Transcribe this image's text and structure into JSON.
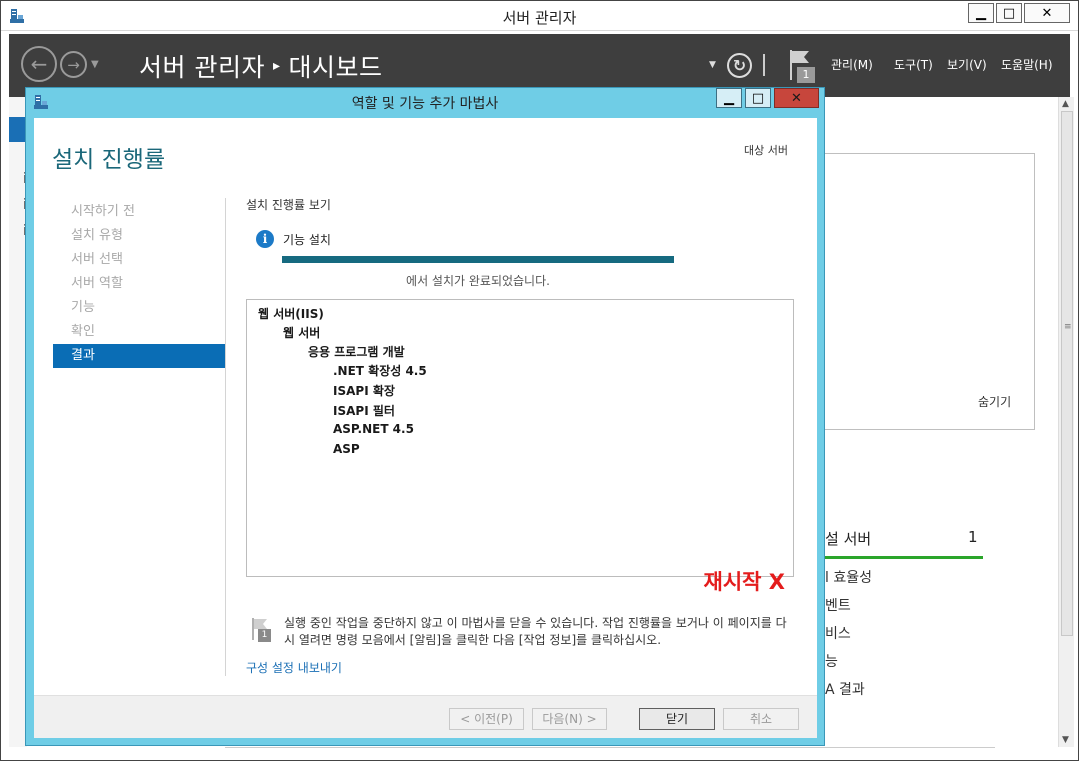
{
  "outer_window": {
    "title": "서버 관리자",
    "controls": {
      "minimize": "▁",
      "maximize": "□",
      "close": "✕"
    }
  },
  "header": {
    "app_name": "서버 관리자",
    "separator": "▸",
    "page_name": "대시보드",
    "menus": [
      "관리(M)",
      "도구(T)",
      "보기(V)",
      "도움말(H)"
    ],
    "notification_count": "1"
  },
  "background": {
    "hide_label": "숨기기",
    "group_title_fragment": "설 서버",
    "group_count": "1",
    "group_bar_color": "#2aa52a",
    "group_items": [
      "l 효율성",
      "벤트",
      "비스",
      "능",
      "A 결과"
    ]
  },
  "wizard": {
    "title": "역할 및 기능 추가 마법사",
    "page_title": "설치 진행률",
    "target_server_label": "대상 서버",
    "steps": [
      {
        "label": "시작하기 전",
        "active": false
      },
      {
        "label": "설치 유형",
        "active": false
      },
      {
        "label": "서버 선택",
        "active": false
      },
      {
        "label": "서버 역할",
        "active": false
      },
      {
        "label": "기능",
        "active": false
      },
      {
        "label": "확인",
        "active": false
      },
      {
        "label": "결과",
        "active": true
      }
    ],
    "view_progress_label": "설치 진행률 보기",
    "feature_install_label": "기능 설치",
    "progress_percent": 100,
    "progress_message": "에서 설치가 완료되었습니다.",
    "results": [
      {
        "text": "웹 서버(IIS)",
        "level": 0
      },
      {
        "text": "웹 서버",
        "level": 1
      },
      {
        "text": "응용 프로그램 개발",
        "level": 2
      },
      {
        "text": ".NET 확장성 4.5",
        "level": 3
      },
      {
        "text": "ISAPI 확장",
        "level": 3
      },
      {
        "text": "ISAPI 필터",
        "level": 3
      },
      {
        "text": "ASP.NET 4.5",
        "level": 3
      },
      {
        "text": "ASP",
        "level": 3
      }
    ],
    "restart_note": "재시작 X",
    "notice_count": "1",
    "notice_text": "실행 중인 작업을 중단하지 않고 이 마법사를 닫을 수 있습니다. 작업 진행률을 보거나 이 페이지를 다시 열려면 명령 모음에서 [알림]을 클릭한 다음 [작업 정보]를 클릭하십시오.",
    "export_link": "구성 설정 내보내기",
    "buttons": {
      "prev": "< 이전(P)",
      "next": "다음(N) >",
      "close": "닫기",
      "cancel": "취소"
    },
    "colors": {
      "accent": "#0a6db5",
      "frame": "#6fcde6",
      "progress": "#166a80",
      "restart": "#e41c1c"
    }
  }
}
